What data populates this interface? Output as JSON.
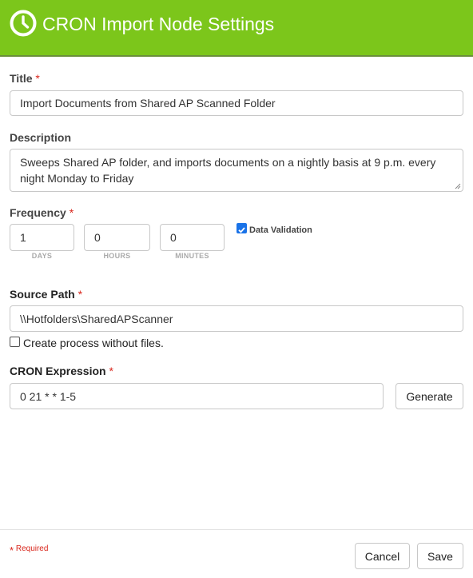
{
  "header": {
    "title": "CRON Import Node Settings",
    "icon": "clock-icon",
    "background_color": "#7cc61b"
  },
  "form": {
    "title": {
      "label": "Title",
      "required_marker": "*",
      "value": "Import Documents from Shared AP Scanned Folder"
    },
    "description": {
      "label": "Description",
      "value": "Sweeps Shared AP folder, and imports documents on a nightly basis at 9 p.m. every night Monday to Friday"
    },
    "frequency": {
      "label": "Frequency",
      "required_marker": "*",
      "days": {
        "value": "1",
        "caption": "DAYS"
      },
      "hours": {
        "value": "0",
        "caption": "HOURS"
      },
      "minutes": {
        "value": "0",
        "caption": "MINUTES"
      },
      "data_validation": {
        "label": "Data Validation",
        "checked": true
      }
    },
    "source_path": {
      "label": "Source Path",
      "required_marker": "*",
      "value": "\\\\Hotfolders\\SharedAPScanner",
      "create_without_files": {
        "label": "Create process without files.",
        "checked": false
      }
    },
    "cron_expression": {
      "label": "CRON Expression",
      "required_marker": "*",
      "value": "0 21 * * 1-5",
      "generate_label": "Generate"
    }
  },
  "footer": {
    "required_marker": "*",
    "required_note": "Required",
    "cancel_label": "Cancel",
    "save_label": "Save"
  }
}
